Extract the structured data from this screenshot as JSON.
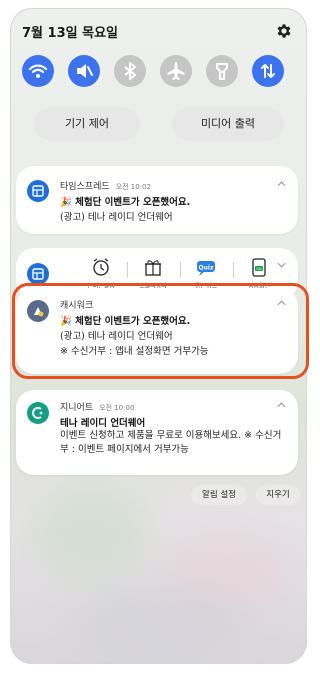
{
  "header": {
    "date": "7월 13일 목요일"
  },
  "quick_toggles": [
    {
      "name": "wifi",
      "state": "on"
    },
    {
      "name": "mute",
      "state": "on"
    },
    {
      "name": "bluetooth",
      "state": "off"
    },
    {
      "name": "airplane",
      "state": "off"
    },
    {
      "name": "flashlight",
      "state": "off"
    },
    {
      "name": "mobile-data",
      "state": "on"
    }
  ],
  "panels": {
    "device_control": "기기 제어",
    "media_output": "미디어 출력"
  },
  "notifications": {
    "timespread": {
      "app": "타임스프레드",
      "time": "오전 10:02",
      "emoji": "🎉",
      "line1": "체험단 이벤트가 오픈했어요.",
      "line2": "(광고) 테나 레이디 언더웨어"
    },
    "shortcuts": [
      {
        "label": "돈버는알람"
      },
      {
        "label": "오늘의상자"
      },
      {
        "label": "용돈퀴즈"
      },
      {
        "label": "잠금화면"
      }
    ],
    "cashwalk": {
      "app": "캐시워크",
      "emoji": "🎉",
      "line1": "체험단 이벤트가 오픈했어요.",
      "line2": "(광고) 테나 레이디 언더웨어",
      "line3": "※ 수신거부 : 앱내 설정화면 거부가능"
    },
    "genie": {
      "app": "지니어트",
      "time": "오전 10:00",
      "title": "테나 레이디 언더웨어",
      "body": "이벤트 신청하고 제품을 무료로 이용해보세요. ※ 수신거부 : 이벤트 페이지에서 거부가능"
    }
  },
  "actions": {
    "settings": "알림 설정",
    "clear": "지우기"
  },
  "colors": {
    "accent": "#3e73ee",
    "highlight": "#e4501f"
  }
}
